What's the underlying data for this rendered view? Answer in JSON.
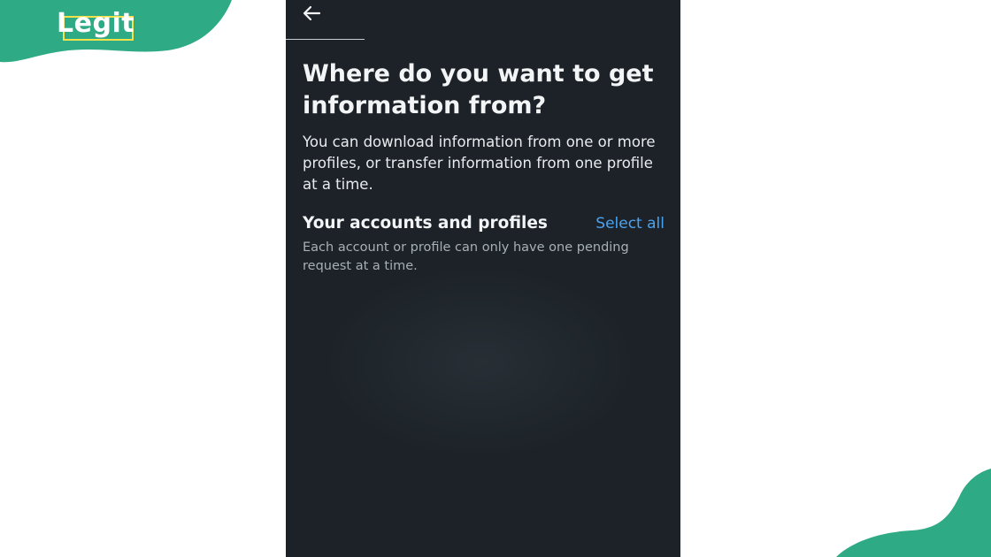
{
  "watermark": {
    "logo_text": "Legit",
    "brand_color": "#2eaa85",
    "accent_color": "#f3e24a"
  },
  "screen": {
    "back_icon": "arrow-left-icon",
    "title": "Where do you want to get information from?",
    "description": "You can download information from one or more profiles, or transfer information from one profile at a time.",
    "section": {
      "heading": "Your accounts and profiles",
      "action_label": "Select all",
      "note": "Each account or profile can only have one pending request at a time."
    },
    "colors": {
      "background": "#1c2228",
      "link": "#4aa3f0"
    }
  }
}
